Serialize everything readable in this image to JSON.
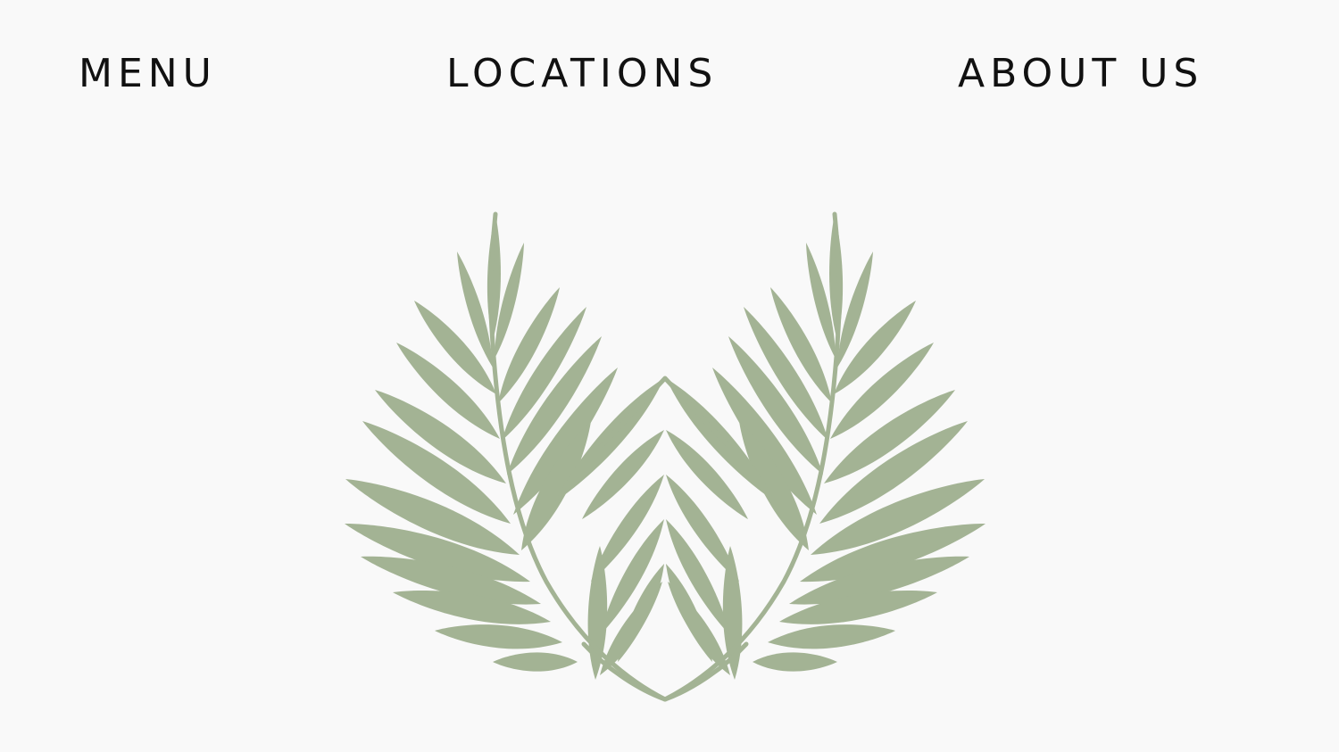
{
  "nav": {
    "items": [
      {
        "label": "MENU"
      },
      {
        "label": "LOCATIONS"
      },
      {
        "label": "ABOUT US"
      }
    ]
  },
  "logo": {
    "icon": "palm-leaf-crest-icon",
    "color": "#a3b394"
  },
  "colors": {
    "background": "#f9f9f9",
    "text": "#111111"
  }
}
